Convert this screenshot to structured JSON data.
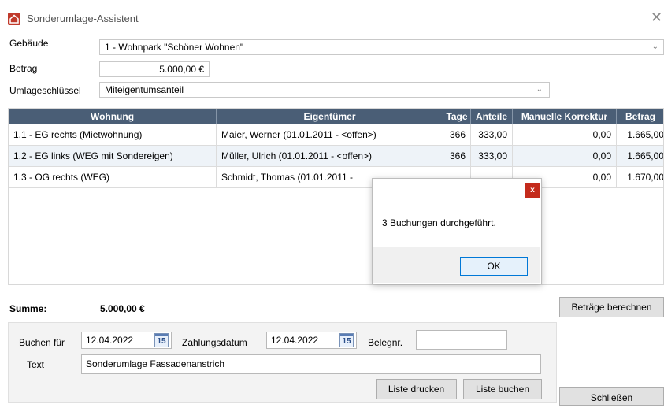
{
  "window": {
    "title": "Sonderumlage-Assistent"
  },
  "form": {
    "gebaeude_label": "Gebäude",
    "gebaeude_value": "1 - Wohnpark \"Schöner Wohnen\"",
    "betrag_label": "Betrag",
    "betrag_value": "5.000,00 €",
    "umlage_label": "Umlageschlüssel",
    "umlage_value": "Miteigentumsanteil"
  },
  "table": {
    "columns": [
      "Wohnung",
      "Eigentümer",
      "Tage",
      "Anteile",
      "Manuelle Korrektur",
      "Betrag"
    ],
    "rows": [
      [
        "1.1 - EG rechts (Mietwohnung)",
        "Maier, Werner (01.01.2011 - <offen>)",
        "366",
        "333,00",
        "0,00",
        "1.665,00"
      ],
      [
        "1.2 - EG links (WEG mit Sondereigen)",
        "Müller, Ulrich (01.01.2011 - <offen>)",
        "366",
        "333,00",
        "0,00",
        "1.665,00"
      ],
      [
        "1.3 - OG rechts (WEG)",
        "Schmidt, Thomas (01.01.2011 -",
        "",
        "",
        "0,00",
        "1.670,00"
      ]
    ]
  },
  "summary": {
    "label": "Summe:",
    "value": "5.000,00 €",
    "calc_button": "Beträge berechnen"
  },
  "booking": {
    "buchen_fuer_label": "Buchen für",
    "buchen_fuer_date": "12.04.2022",
    "zahlungsdatum_label": "Zahlungsdatum",
    "zahlungsdatum_date": "12.04.2022",
    "calendar_day": "15",
    "belegnr_label": "Belegnr.",
    "belegnr_value": "",
    "text_label": "Text",
    "text_value": "Sonderumlage Fassadenanstrich",
    "print_button": "Liste drucken",
    "book_button": "Liste buchen"
  },
  "close_button": "Schließen",
  "dialog": {
    "message": "3 Buchungen durchgeführt.",
    "ok_button": "OK",
    "close_glyph": "x"
  },
  "colors": {
    "header_bg": "#4a5e76",
    "app_icon": "#c0392b",
    "dialog_close": "#c42b1c"
  }
}
